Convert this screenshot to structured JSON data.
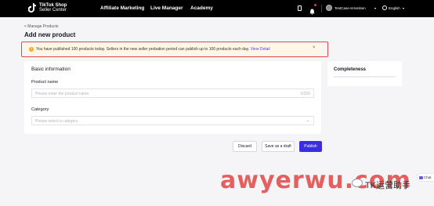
{
  "header": {
    "logo_line1": "TikTok Shop",
    "logo_line2": "Seller Center",
    "nav": [
      "Affiliate Marketing",
      "Live Manager",
      "Academy"
    ],
    "account_name": "TestCase-st-tenlsen",
    "language": "English"
  },
  "breadcrumb": "< Manage Products",
  "page_title": "Add new product",
  "notice": {
    "text": "You have published 100 products today. Sellers in the new seller probation period can publish up to 100 products each day.",
    "link": "View Detail",
    "close": "×"
  },
  "basic_info": {
    "title": "Basic information",
    "product_name_label": "Product name",
    "product_name_placeholder": "Please enter the product name",
    "product_name_counter": "0/255",
    "category_label": "Category",
    "category_placeholder": "Please select a category"
  },
  "completeness": {
    "title": "Completeness",
    "progress": 0
  },
  "actions": {
    "discard": "Discard",
    "save_draft": "Save as a draft",
    "publish": "Publish"
  },
  "watermark": {
    "text": "awyerwu.com",
    "caption": "TK运营助手"
  },
  "chat": "Chat",
  "colors": {
    "primary": "#3c2ee0",
    "notice_bg": "#fff7e6",
    "notice_highlight": "#e8473f",
    "topbar": "#000000"
  }
}
